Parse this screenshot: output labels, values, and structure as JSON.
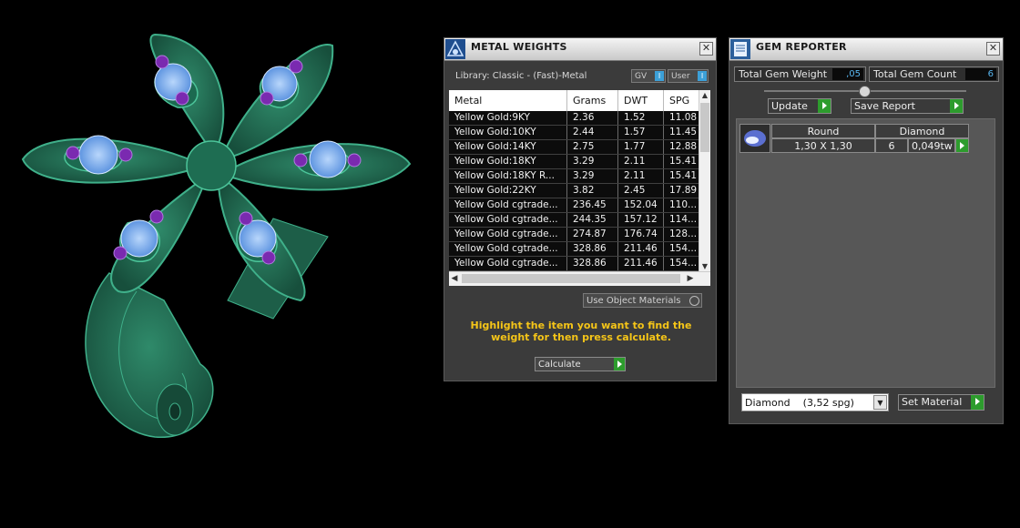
{
  "metal_weights": {
    "title": "METAL WEIGHTS",
    "library_label": "Library: Classic - (Fast)-Metal",
    "gv_button": "GV",
    "user_button": "User",
    "toggle_glyph": "I",
    "columns": [
      "Metal",
      "Grams",
      "DWT",
      "SPG"
    ],
    "rows": [
      [
        "Yellow Gold:9KY",
        "2.36",
        "1.52",
        "11.08"
      ],
      [
        "Yellow Gold:10KY",
        "2.44",
        "1.57",
        "11.45"
      ],
      [
        "Yellow Gold:14KY",
        "2.75",
        "1.77",
        "12.88"
      ],
      [
        "Yellow Gold:18KY",
        "3.29",
        "2.11",
        "15.41"
      ],
      [
        "Yellow Gold:18KY R...",
        "3.29",
        "2.11",
        "15.41"
      ],
      [
        "Yellow Gold:22KY",
        "3.82",
        "2.45",
        "17.89"
      ],
      [
        "Yellow Gold cgtrade...",
        "236.45",
        "152.04",
        "110..."
      ],
      [
        "Yellow Gold cgtrade...",
        "244.35",
        "157.12",
        "114..."
      ],
      [
        "Yellow Gold cgtrade...",
        "274.87",
        "176.74",
        "128..."
      ],
      [
        "Yellow Gold cgtrade...",
        "328.86",
        "211.46",
        "154..."
      ],
      [
        "Yellow Gold cgtrade...",
        "328.86",
        "211.46",
        "154..."
      ]
    ],
    "use_object_materials": "Use Object Materials",
    "hint": "Highlight the item you want to find the weight for then press calculate.",
    "calculate_label": "Calculate"
  },
  "gem_reporter": {
    "title": "GEM REPORTER",
    "total_weight_label": "Total Gem Weight",
    "total_weight_value": ",05",
    "total_count_label": "Total Gem Count",
    "total_count_value": "6",
    "update_label": "Update",
    "save_report_label": "Save Report",
    "gem_row": {
      "shape": "Round",
      "material": "Diamond",
      "size": "1,30 X 1,30",
      "count": "6",
      "weight": "0,049tw"
    },
    "material_select": "Diamond    (3,52 spg)",
    "set_material_label": "Set Material"
  },
  "colors": {
    "accent_green": "#2d9c2d",
    "hint_yellow": "#f5c518",
    "value_blue": "#58b6f0",
    "ring_green": "#1f6e55",
    "gem_blue": "#7fb2ee",
    "gem_purple": "#7a2ab0"
  }
}
